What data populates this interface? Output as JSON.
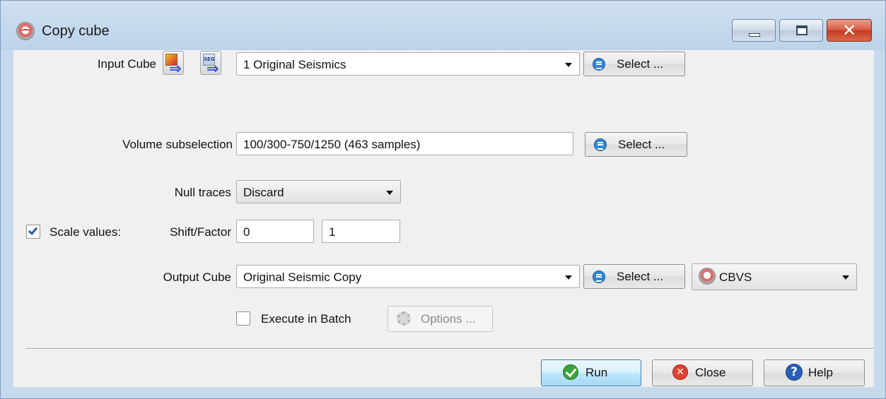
{
  "window": {
    "title": "Copy cube"
  },
  "input_cube": {
    "label": "Input Cube",
    "value": "1 Original Seismics",
    "select_label": "Select ...",
    "import_icon_text": "SEG"
  },
  "volume_subselection": {
    "label": "Volume subselection",
    "value": "100/300-750/1250 (463 samples)",
    "select_label": "Select ..."
  },
  "null_traces": {
    "label": "Null traces",
    "value": "Discard"
  },
  "scale_values": {
    "checkbox_label": "Scale values:",
    "checked": true,
    "shift_factor_label": "Shift/Factor",
    "shift": "0",
    "factor": "1"
  },
  "output_cube": {
    "label": "Output Cube",
    "value": "Original Seismic Copy",
    "select_label": "Select ...",
    "format": "CBVS"
  },
  "batch": {
    "label": "Execute in Batch",
    "checked": false,
    "options_label": "Options ..."
  },
  "footer": {
    "run_label": "Run",
    "close_label": "Close",
    "help_label": "Help"
  }
}
